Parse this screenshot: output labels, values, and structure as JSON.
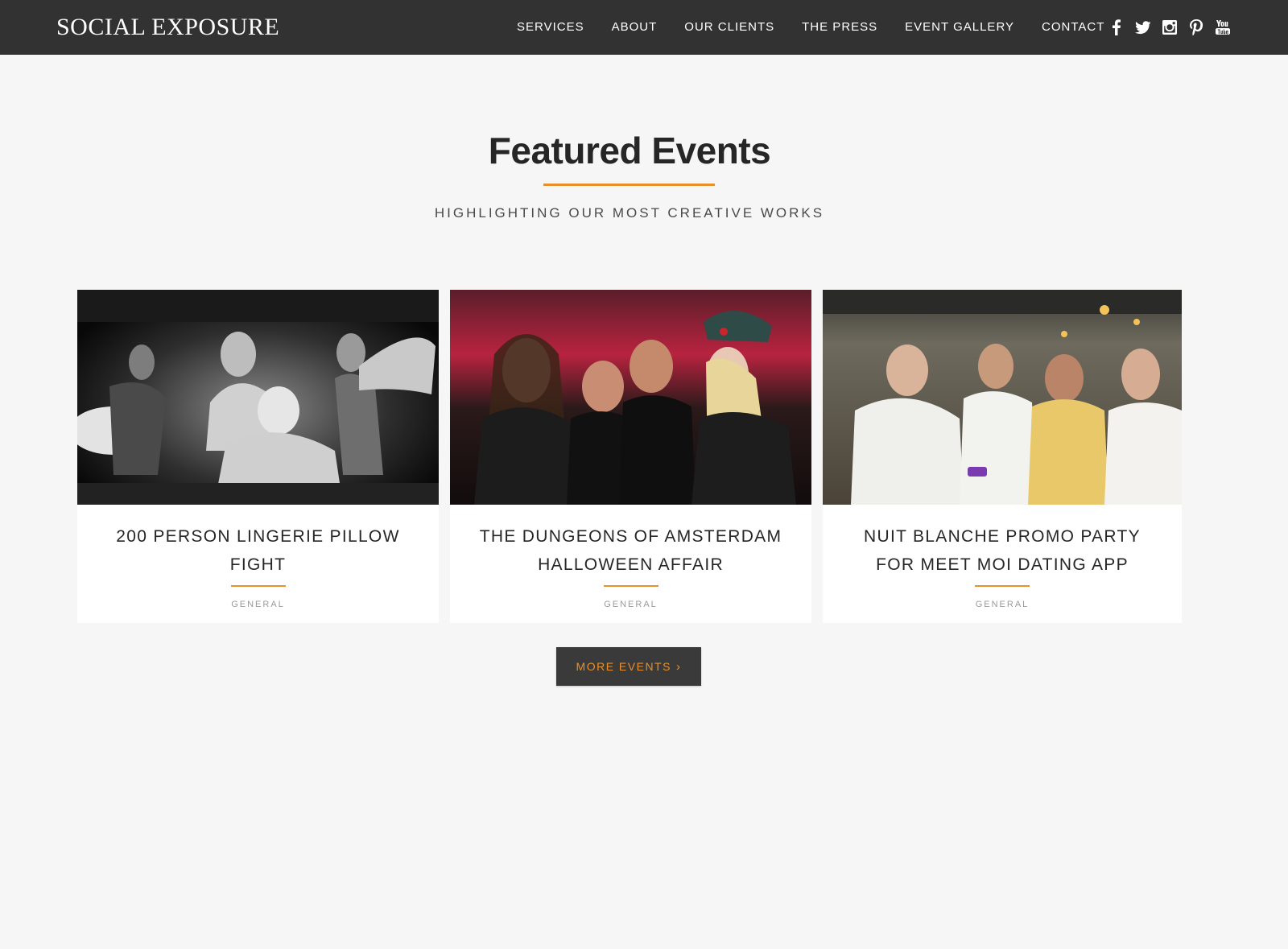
{
  "brand": {
    "name": "SOCIAL EXPOSURE"
  },
  "nav": {
    "items": [
      {
        "label": "SERVICES"
      },
      {
        "label": "ABOUT"
      },
      {
        "label": "OUR CLIENTS"
      },
      {
        "label": "THE PRESS"
      },
      {
        "label": "EVENT GALLERY"
      },
      {
        "label": "CONTACT"
      }
    ],
    "social_icons": [
      "facebook-icon",
      "twitter-icon",
      "instagram-icon",
      "pinterest-icon",
      "youtube-icon"
    ]
  },
  "section": {
    "title": "Featured Events",
    "subtitle": "HIGHLIGHTING OUR MOST CREATIVE WORKS"
  },
  "events": [
    {
      "title": "200 PERSON LINGERIE PILLOW FIGHT",
      "category": "GENERAL"
    },
    {
      "title": "THE DUNGEONS OF AMSTERDAM HALLOWEEN AFFAIR",
      "category": "GENERAL"
    },
    {
      "title": "NUIT BLANCHE PROMO PARTY FOR MEET MOI DATING APP",
      "category": "GENERAL"
    }
  ],
  "more_button": {
    "label": "MORE EVENTS",
    "icon": "chevron-right-icon"
  },
  "colors": {
    "navbar_bg": "#323232",
    "page_bg": "#f6f6f6",
    "accent": "#e8902a",
    "button_bg": "#3a3a3a",
    "heading": "#262626"
  }
}
